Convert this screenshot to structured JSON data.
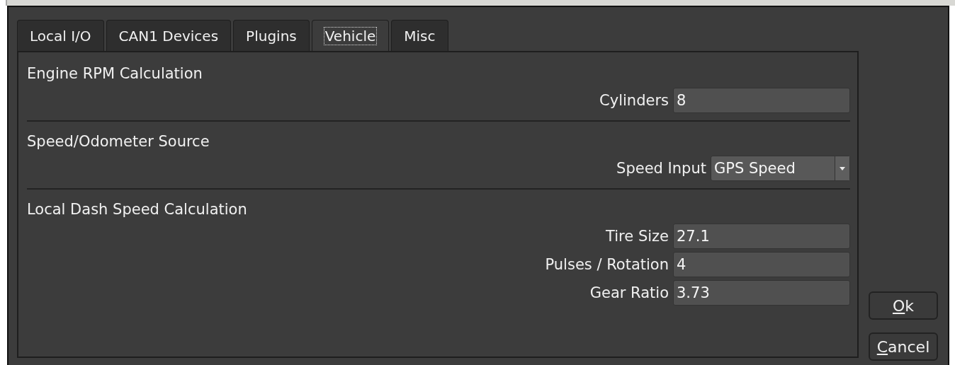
{
  "tabs": [
    {
      "label": "Local I/O",
      "selected": false
    },
    {
      "label": "CAN1 Devices",
      "selected": false
    },
    {
      "label": "Plugins",
      "selected": false
    },
    {
      "label": "Vehicle",
      "selected": true
    },
    {
      "label": "Misc",
      "selected": false
    }
  ],
  "sections": [
    {
      "title": "Engine RPM Calculation",
      "fields": [
        {
          "kind": "input",
          "label": "Cylinders",
          "value": "8"
        }
      ]
    },
    {
      "title": "Speed/Odometer Source",
      "fields": [
        {
          "kind": "select",
          "label": "Speed Input",
          "value": "GPS Speed"
        }
      ]
    },
    {
      "title": "Local Dash Speed Calculation",
      "fields": [
        {
          "kind": "input",
          "label": "Tire Size",
          "value": "27.1"
        },
        {
          "kind": "input",
          "label": "Pulses / Rotation",
          "value": "4"
        },
        {
          "kind": "input",
          "label": "Gear Ratio",
          "value": "3.73"
        }
      ]
    }
  ],
  "buttons": [
    "Ok",
    "Cancel"
  ]
}
